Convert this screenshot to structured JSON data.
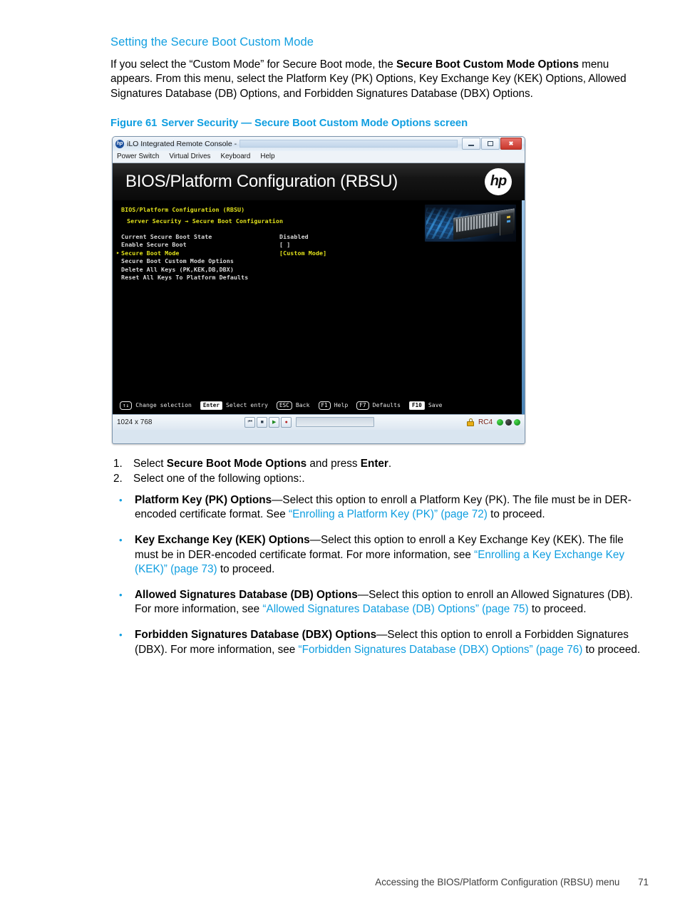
{
  "section": {
    "heading": "Setting the Secure Boot Custom Mode",
    "paragraph_part1": "If you select the “Custom Mode” for Secure Boot mode, the ",
    "paragraph_bold": "Secure Boot Custom Mode Options",
    "paragraph_part2": " menu appears. From this menu, select the Platform Key (PK) Options, Key Exchange Key (KEK) Options, Allowed Signatures Database (DB) Options, and Forbidden Signatures Database (DBX) Options."
  },
  "figure": {
    "number": "Figure 61",
    "caption": "Server Security — Secure Boot Custom Mode Options screen"
  },
  "console": {
    "window_title": "iLO Integrated Remote Console -",
    "hp_badge": "hp",
    "window_controls": {
      "minimize": "minimize-icon",
      "maximize": "maximize-icon",
      "close": "✖"
    },
    "menus": [
      "Power Switch",
      "Virtual Drives",
      "Keyboard",
      "Help"
    ],
    "rbsu_title": "BIOS/Platform Configuration (RBSU)",
    "hp_logo": "hp",
    "bios": {
      "title": "BIOS/Platform Configuration (RBSU)",
      "breadcrumb": "Server Security → Secure Boot Configuration",
      "selected_arrow": "▸",
      "rows": [
        {
          "label": "Current Secure Boot State",
          "value": "Disabled",
          "selected": false,
          "arrow": false
        },
        {
          "label": "Enable Secure Boot",
          "value": "[ ]",
          "selected": false,
          "arrow": false
        },
        {
          "label": "Secure Boot Mode",
          "value": "[Custom Mode]",
          "selected": true,
          "arrow": true
        },
        {
          "label": "Secure Boot Custom Mode Options",
          "value": "",
          "selected": false,
          "arrow": false
        },
        {
          "label": "Delete All Keys (PK,KEK,DB,DBX)",
          "value": "",
          "selected": false,
          "arrow": false
        },
        {
          "label": "Reset All Keys To Platform Defaults",
          "value": "",
          "selected": false,
          "arrow": false
        }
      ],
      "help_keys": [
        {
          "key": "↑↓",
          "text": "Change selection",
          "solid": false
        },
        {
          "key": "Enter",
          "text": "Select entry",
          "solid": true
        },
        {
          "key": "ESC",
          "text": "Back",
          "solid": false
        },
        {
          "key": "F1",
          "text": "Help",
          "solid": false
        },
        {
          "key": "F7",
          "text": "Defaults",
          "solid": false
        },
        {
          "key": "F10",
          "text": "Save",
          "solid": true
        }
      ]
    },
    "status": {
      "resolution": "1024 x 768",
      "vcr": [
        "⏮",
        "■",
        "▶",
        "●"
      ],
      "cipher": "RC4",
      "lock": "lock-icon"
    }
  },
  "steps": [
    {
      "num": "1.",
      "segments": [
        {
          "t": "Select ",
          "b": false
        },
        {
          "t": "Secure Boot Mode Options",
          "b": true
        },
        {
          "t": " and press ",
          "b": false
        },
        {
          "t": "Enter",
          "b": true
        },
        {
          "t": ".",
          "b": false
        }
      ]
    },
    {
      "num": "2.",
      "segments": [
        {
          "t": "Select one of the following options:.",
          "b": false
        }
      ]
    }
  ],
  "bullets": [
    {
      "marker": "•",
      "segments": [
        {
          "t": "Platform Key (PK) Options",
          "b": true
        },
        {
          "t": "—Select this option to enroll a Platform Key (PK). The file must be in DER-encoded certificate format. See ",
          "b": false
        },
        {
          "t": "“Enrolling a Platform Key (PK)” (page 72)",
          "link": true
        },
        {
          "t": " to proceed.",
          "b": false
        }
      ]
    },
    {
      "marker": "•",
      "segments": [
        {
          "t": "Key Exchange Key (KEK) Options",
          "b": true
        },
        {
          "t": "—Select this option to enroll a Key Exchange Key (KEK). The file must be in DER-encoded certificate format. For more information, see ",
          "b": false
        },
        {
          "t": "“Enrolling a Key Exchange Key (KEK)” (page 73)",
          "link": true
        },
        {
          "t": " to proceed.",
          "b": false
        }
      ]
    },
    {
      "marker": "•",
      "segments": [
        {
          "t": "Allowed Signatures Database (DB) Options",
          "b": true
        },
        {
          "t": "—Select this option to enroll an Allowed Signatures (DB). For more information, see ",
          "b": false
        },
        {
          "t": "“Allowed Signatures Database (DB) Options” (page 75)",
          "link": true
        },
        {
          "t": " to proceed.",
          "b": false
        }
      ]
    },
    {
      "marker": "•",
      "segments": [
        {
          "t": "Forbidden Signatures Database (DBX) Options",
          "b": true
        },
        {
          "t": "—Select this option to enroll a Forbidden Signatures (DBX). For more information, see ",
          "b": false
        },
        {
          "t": "“Forbidden Signatures Database (DBX) Options” (page 76)",
          "link": true
        },
        {
          "t": " to proceed.",
          "b": false
        }
      ]
    }
  ],
  "footer": {
    "text": "Accessing the BIOS/Platform Configuration (RBSU) menu",
    "page": "71"
  },
  "colors": {
    "accent": "#0f9ee0",
    "bios_yellow": "#e2e21b",
    "bios_bg": "#000000"
  }
}
